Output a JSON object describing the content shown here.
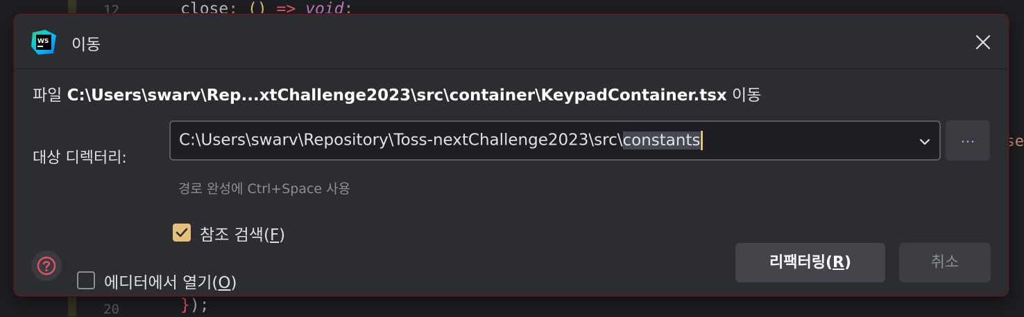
{
  "editor": {
    "line_numbers": [
      "12",
      "20"
    ],
    "line_12_code": {
      "prop": "close",
      "colon": ":",
      "parens": "()",
      "arrow": "=>",
      "type": "void",
      "semicolon": ";"
    },
    "line_20_code": {
      "brace": "}",
      "paren_close": ");"
    },
    "edge_fragment": "se"
  },
  "dialog": {
    "title": "이동",
    "file_line": {
      "prefix": "파일",
      "path": "C:\\Users\\swarv\\Rep...xtChallenge2023\\src\\container\\KeypadContainer.tsx",
      "suffix": "이동"
    },
    "target_dir": {
      "label": "대상 디렉터리:",
      "value_prefix": "C:\\Users\\swarv\\Repository\\Toss-nextChallenge2023\\src\\",
      "value_selected": "constants",
      "browse_label": "...",
      "hint": "경로 완성에 Ctrl+Space 사용"
    },
    "search_refs": {
      "label_prefix": "참조 검색(",
      "mnemonic": "F",
      "label_suffix": ")",
      "checked": true
    },
    "open_in_editor": {
      "label_prefix": "에디터에서 열기(",
      "mnemonic": "O",
      "label_suffix": ")",
      "checked": false
    },
    "buttons": {
      "refactor": {
        "prefix": "리팩터링(",
        "mnemonic": "R",
        "suffix": ")"
      },
      "cancel": "취소"
    }
  },
  "colors": {
    "accent_yellow": "#e5c07b",
    "help_icon": "#e05561",
    "dialog_bg": "#2b2d30"
  }
}
